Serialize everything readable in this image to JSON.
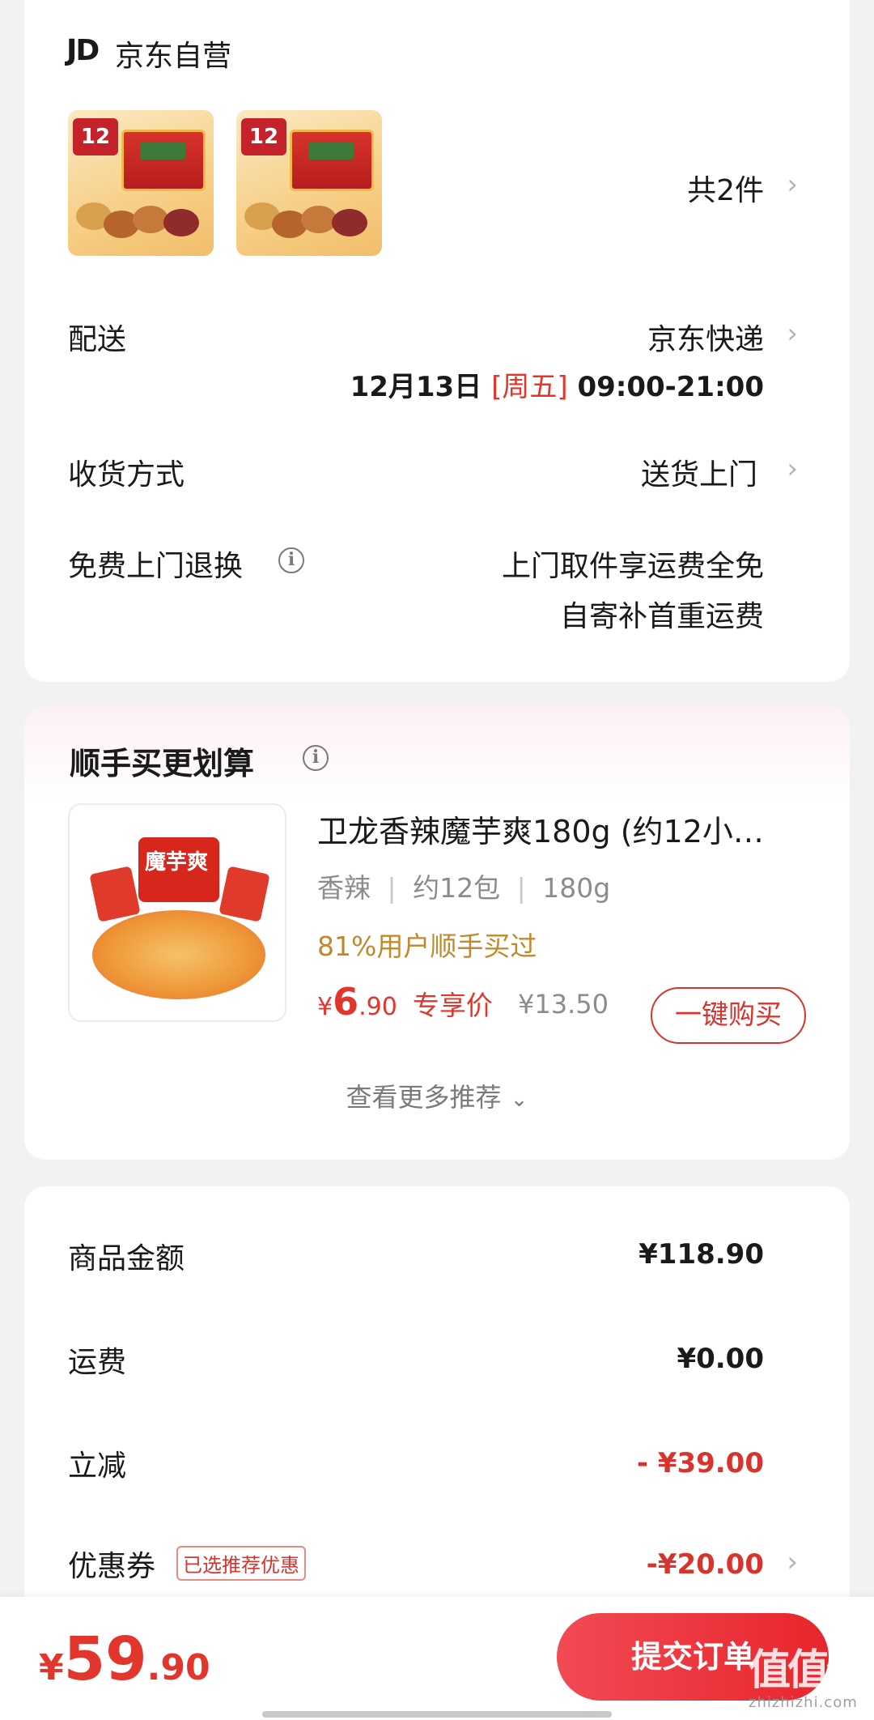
{
  "store": {
    "logo": "JD",
    "name": "京东自营",
    "items_count": "共2件",
    "thumb_badge": "12"
  },
  "delivery": {
    "label": "配送",
    "method": "京东快递",
    "date": "12月13日",
    "weekday": "[周五]",
    "time": "09:00-21:00"
  },
  "receive": {
    "label": "收货方式",
    "value": "送货上门"
  },
  "return": {
    "label": "免费上门退换",
    "line1": "上门取件享运费全免",
    "line2": "自寄补首重运费"
  },
  "recommend": {
    "title": "顺手买更划算",
    "product_name": "卫龙香辣魔芋爽180g (约12小…",
    "spec1": "香辣",
    "spec2": "约12包",
    "spec3": "180g",
    "bought_pct": "81%用户顺手买过",
    "price_symbol": "¥",
    "price_int": "6",
    "price_dec": ".90",
    "price_tag": "专享价",
    "orig_price": "¥13.50",
    "buy_label": "一键购买",
    "more_label": "查看更多推荐",
    "img_text": "魔芋爽"
  },
  "summary": {
    "goods_label": "商品金额",
    "goods_value": "¥118.90",
    "shipping_label": "运费",
    "shipping_value": "¥0.00",
    "discount_label": "立减",
    "discount_value": "- ¥39.00",
    "coupon_label": "优惠券",
    "coupon_tag": "已选推荐优惠",
    "coupon_value": "-¥20.00"
  },
  "bottom": {
    "currency": "¥",
    "total_int": "59",
    "total_dec": ".90",
    "submit_label": "提交订单"
  },
  "watermark": {
    "logo": "值值值",
    "site": "zhizhizhi.com"
  },
  "colors": {
    "accent_red": "#e2352b",
    "pct_gold": "#c08a2c",
    "bg": "#f2f2f2"
  }
}
